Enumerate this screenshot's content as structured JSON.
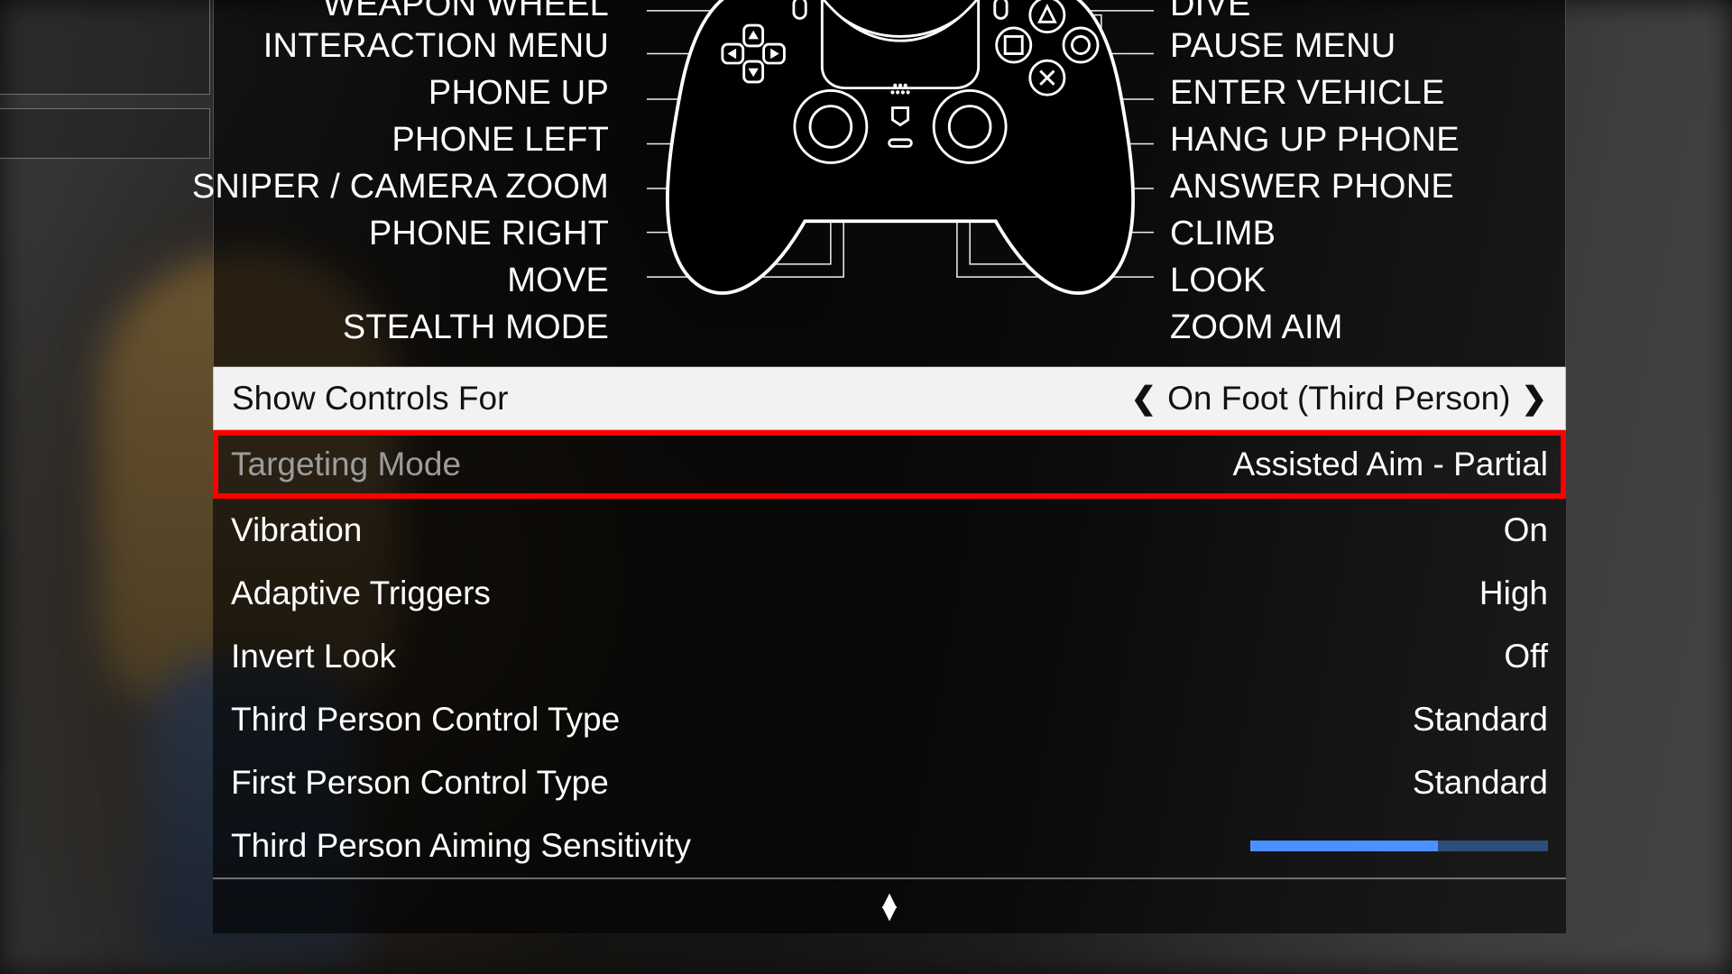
{
  "controller_labels": {
    "left": {
      "weapon_wheel": "WEAPON WHEEL",
      "interaction_menu": "INTERACTION MENU",
      "phone_up": "PHONE UP",
      "phone_left": "PHONE LEFT",
      "sniper_zoom": "SNIPER / CAMERA ZOOM",
      "phone_right": "PHONE RIGHT",
      "move": "MOVE",
      "stealth_mode": "STEALTH MODE"
    },
    "right": {
      "dive": "DIVE",
      "pause_menu": "PAUSE MENU",
      "enter_vehicle": "ENTER VEHICLE",
      "hang_up_phone": "HANG UP PHONE",
      "answer_phone": "ANSWER PHONE",
      "climb": "CLIMB",
      "look": "LOOK",
      "zoom_aim": "ZOOM AIM"
    }
  },
  "selector": {
    "label": "Show Controls For",
    "value": "On Foot (Third Person)"
  },
  "highlight": {
    "label": "Targeting Mode",
    "value": "Assisted Aim - Partial"
  },
  "settings": [
    {
      "label": "Vibration",
      "value": "On"
    },
    {
      "label": "Adaptive Triggers",
      "value": "High"
    },
    {
      "label": "Invert Look",
      "value": "Off"
    },
    {
      "label": "Third Person Control Type",
      "value": "Standard"
    },
    {
      "label": "First Person Control Type",
      "value": "Standard"
    }
  ],
  "slider": {
    "label": "Third Person Aiming Sensitivity",
    "percent": 63
  }
}
